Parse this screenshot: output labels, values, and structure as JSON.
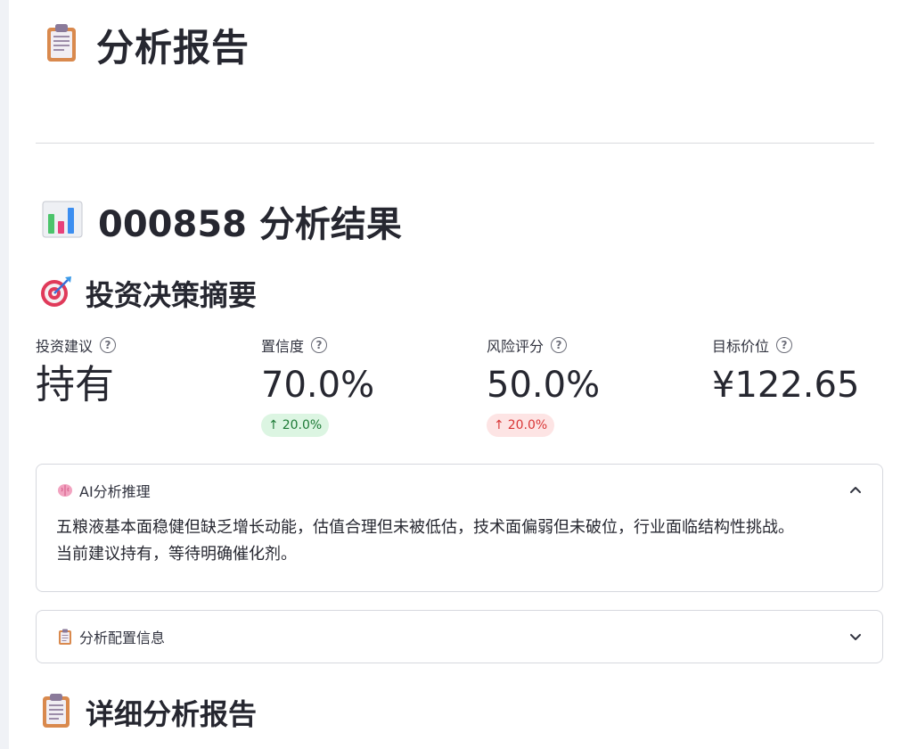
{
  "page": {
    "title": "分析报告",
    "title_icon": "clipboard-icon"
  },
  "result": {
    "title": "000858 分析结果",
    "title_icon": "bar-chart-icon"
  },
  "decision": {
    "title": "投资决策摘要",
    "title_icon": "target-icon",
    "metrics": [
      {
        "label": "投资建议",
        "value": "持有"
      },
      {
        "label": "置信度",
        "value": "70.0%",
        "delta": "20.0%",
        "delta_color": "#1d7a36"
      },
      {
        "label": "风险评分",
        "value": "50.0%",
        "delta": "20.0%",
        "delta_color": "#d93636"
      },
      {
        "label": "目标价位",
        "value": "¥122.65"
      }
    ]
  },
  "reasoning": {
    "label": "AI分析推理",
    "icon": "brain-icon",
    "text": "五粮液基本面稳健但缺乏增长动能，估值合理但未被低估，技术面偏弱但未破位，行业面临结构性挑战。当前建议持有，等待明确催化剂。"
  },
  "config": {
    "label": "分析配置信息",
    "icon": "clipboard-icon"
  },
  "detail": {
    "title": "详细分析报告",
    "title_icon": "clipboard-icon"
  }
}
